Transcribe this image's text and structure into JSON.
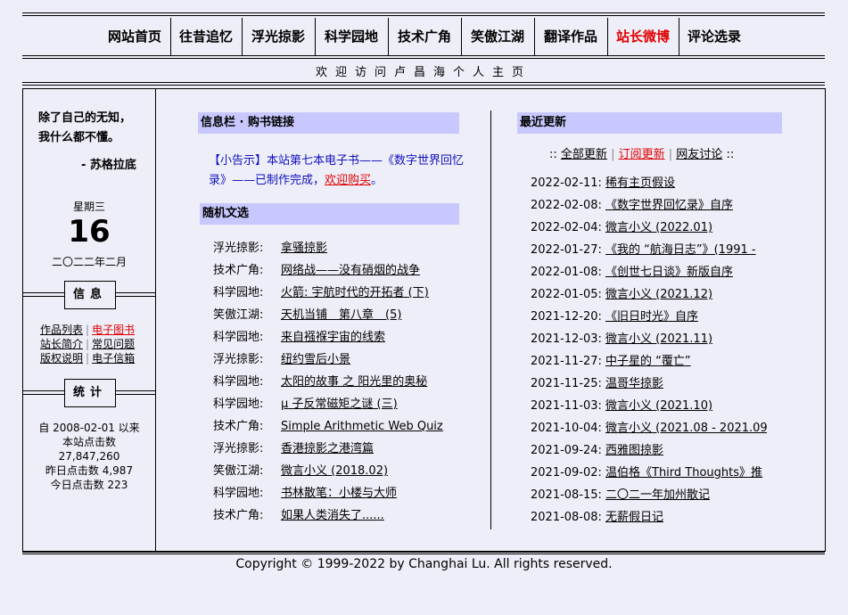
{
  "nav": {
    "items": [
      {
        "label": "网站首页",
        "active": false
      },
      {
        "label": "往昔追忆",
        "active": false
      },
      {
        "label": "浮光掠影",
        "active": false
      },
      {
        "label": "科学园地",
        "active": false
      },
      {
        "label": "技术广角",
        "active": false
      },
      {
        "label": "笑傲江湖",
        "active": false
      },
      {
        "label": "翻译作品",
        "active": false
      },
      {
        "label": "站长微博",
        "active": true
      },
      {
        "label": "评论选录",
        "active": false
      }
    ]
  },
  "welcome": "欢迎访问卢昌海个人主页",
  "sidebar": {
    "quote_line1": "除了自己的无知，",
    "quote_line2": "我什么都不懂。",
    "quote_author": "- 苏格拉底",
    "weekday": "星期三",
    "day": "16",
    "month": "二〇二二年二月",
    "info_title": "信息",
    "info_links": [
      [
        "作品列表",
        "电子图书"
      ],
      [
        "站长简介",
        "常见问题"
      ],
      [
        "版权说明",
        "电子信箱"
      ]
    ],
    "stats_title": "统计",
    "stats": {
      "since": "自 2008-02-01 以来",
      "total_label": "本站点击数",
      "total": "27,847,260",
      "yesterday": "昨日点击数 4,987",
      "today": "今日点击数 223"
    }
  },
  "middle": {
    "info_header": "信息栏 · 购书链接",
    "notice_prefix": "【小告示】本站第七本电子书——《数字世界回忆录》——已制作完成，",
    "notice_link": "欢迎购买",
    "notice_suffix": "。",
    "random_header": "随机文选",
    "random": [
      {
        "cat": "浮光掠影:",
        "title": "拿骚掠影"
      },
      {
        "cat": "技术广角:",
        "title": "网络战——没有硝烟的战争"
      },
      {
        "cat": "科学园地:",
        "title": "火箭: 宇航时代的开拓者 (下)"
      },
      {
        "cat": "笑傲江湖:",
        "title": "天机当铺　第八章　(5)"
      },
      {
        "cat": "科学园地:",
        "title": "来自襁褓宇宙的线索"
      },
      {
        "cat": "浮光掠影:",
        "title": "纽约雪后小景"
      },
      {
        "cat": "科学园地:",
        "title": "太阳的故事 之 阳光里的奥秘"
      },
      {
        "cat": "科学园地:",
        "title": "μ 子反常磁矩之谜 (三)"
      },
      {
        "cat": "技术广角:",
        "title": "Simple Arithmetic Web Quiz"
      },
      {
        "cat": "浮光掠影:",
        "title": "香港掠影之港湾篇"
      },
      {
        "cat": "笑傲江湖:",
        "title": "微言小义 (2018.02)"
      },
      {
        "cat": "科学园地:",
        "title": "书林散笔：小楼与大师"
      },
      {
        "cat": "技术广角:",
        "title": "如果人类消失了......"
      }
    ]
  },
  "right": {
    "header": "最近更新",
    "links_prefix": "::",
    "links": [
      "全部更新",
      "订阅更新",
      "网友讨论"
    ],
    "links_suffix": "::",
    "updates": [
      {
        "date": "2022-02-11:",
        "title": "稀有主页假设"
      },
      {
        "date": "2022-02-08:",
        "title": "《数字世界回忆录》自序"
      },
      {
        "date": "2022-02-04:",
        "title": "微言小义 (2022.01)"
      },
      {
        "date": "2022-01-27:",
        "title": "《我的 “航海日志”》(1991 -"
      },
      {
        "date": "2022-01-08:",
        "title": "《创世七日谈》新版自序"
      },
      {
        "date": "2022-01-05:",
        "title": "微言小义 (2021.12)"
      },
      {
        "date": "2021-12-20:",
        "title": "《旧日时光》自序"
      },
      {
        "date": "2021-12-03:",
        "title": "微言小义 (2021.11)"
      },
      {
        "date": "2021-11-27:",
        "title": "中子星的 “覆亡”"
      },
      {
        "date": "2021-11-25:",
        "title": "温哥华掠影"
      },
      {
        "date": "2021-11-03:",
        "title": "微言小义 (2021.10)"
      },
      {
        "date": "2021-10-04:",
        "title": "微言小义 (2021.08 - 2021.09)"
      },
      {
        "date": "2021-09-24:",
        "title": "西雅图掠影"
      },
      {
        "date": "2021-09-02:",
        "title": "温伯格《Third Thoughts》推"
      },
      {
        "date": "2021-08-15:",
        "title": "二〇二一年加州散记"
      },
      {
        "date": "2021-08-08:",
        "title": "无薪假日记"
      }
    ]
  },
  "footer": "Copyright © 1999-2022 by Changhai Lu. All rights reserved.",
  "colors": {
    "background": "#eeeef8",
    "header_bar": "#c8c8ff",
    "accent_red": "#e00000",
    "notice_blue": "#1010c0"
  }
}
